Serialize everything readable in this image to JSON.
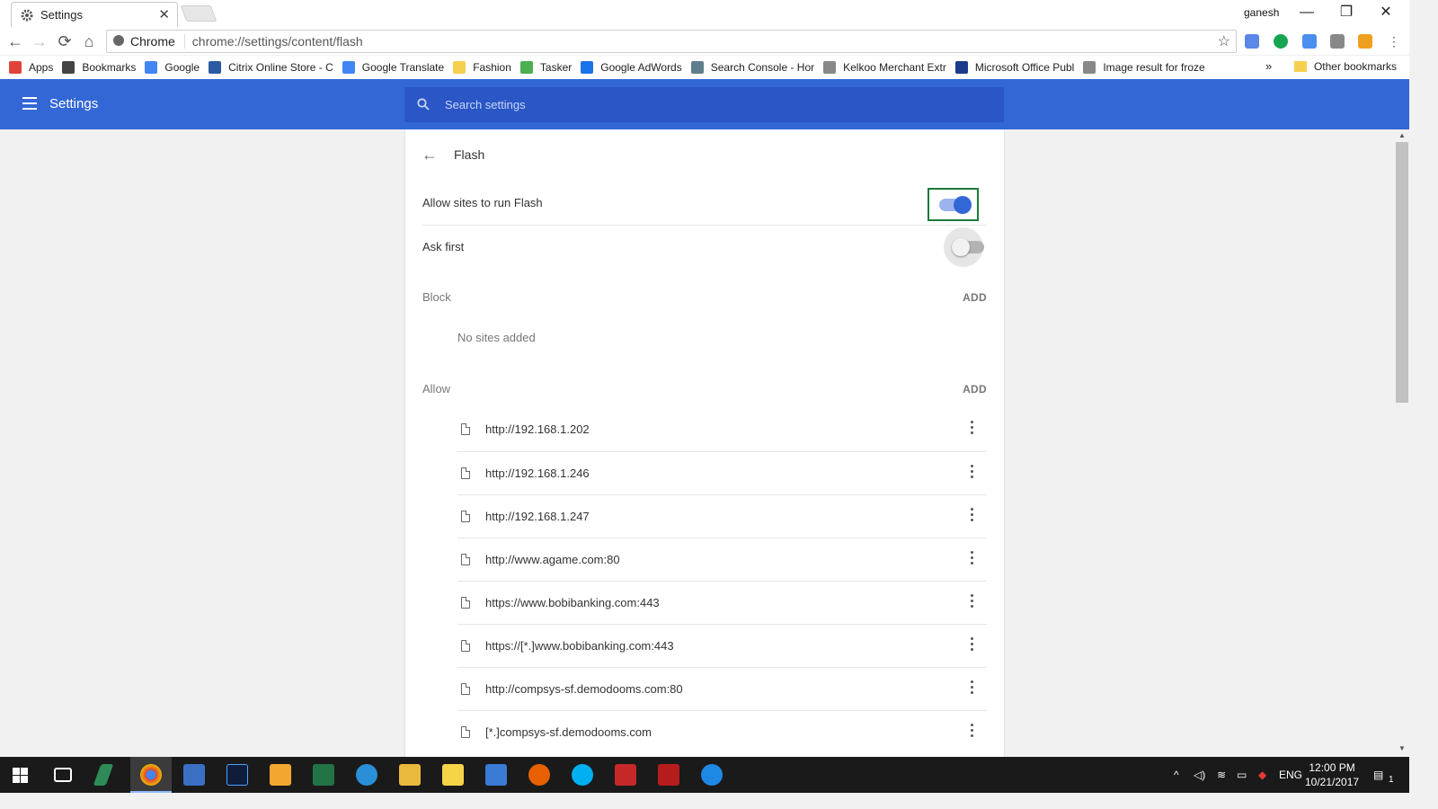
{
  "window": {
    "tab_title": "Settings",
    "tab_close": "✕",
    "user": "ganesh",
    "controls": {
      "minimize": "—",
      "restore": "❐",
      "close": "✕"
    }
  },
  "toolbar": {
    "back": "←",
    "forward": "→",
    "reload": "⟳",
    "home": "⌂",
    "site_chip": "Chrome",
    "url": "chrome://settings/content/flash",
    "star": "☆"
  },
  "bookmarks": {
    "items": [
      {
        "label": "Apps",
        "icon": "apps-grid-icon",
        "color": "#e0433a"
      },
      {
        "label": "Bookmarks",
        "icon": "star-icon",
        "color": "#444444"
      },
      {
        "label": "Google",
        "icon": "google-icon",
        "color": "#4285f4"
      },
      {
        "label": "Citrix Online Store - C",
        "icon": "citrix-icon",
        "color": "#2b5aa3"
      },
      {
        "label": "Google Translate",
        "icon": "translate-icon",
        "color": "#4285f4"
      },
      {
        "label": "Fashion",
        "icon": "folder-icon",
        "color": "#f7cf4f"
      },
      {
        "label": "Tasker",
        "icon": "tasker-icon",
        "color": "#4caf50"
      },
      {
        "label": "Google AdWords",
        "icon": "adwords-icon",
        "color": "#1a73e8"
      },
      {
        "label": "Search Console - Hor",
        "icon": "search-console-icon",
        "color": "#607d8b"
      },
      {
        "label": "Kelkoo Merchant Extr",
        "icon": "page-icon",
        "color": "#888888"
      },
      {
        "label": "Microsoft Office Publ",
        "icon": "office-icon",
        "color": "#1b3a8a"
      },
      {
        "label": "Image result for froze",
        "icon": "page-icon",
        "color": "#888888"
      }
    ],
    "overflow": "»",
    "other": "Other bookmarks"
  },
  "header": {
    "title": "Settings",
    "search_placeholder": "Search settings"
  },
  "flash": {
    "back": "←",
    "title": "Flash",
    "allow_label": "Allow sites to run Flash",
    "allow_on": true,
    "ask_label": "Ask first",
    "ask_on": false,
    "block_label": "Block",
    "block_add": "ADD",
    "block_empty": "No sites added",
    "allow_section_label": "Allow",
    "allow_add": "ADD",
    "allow_sites": [
      "http://192.168.1.202",
      "http://192.168.1.246",
      "http://192.168.1.247",
      "http://www.agame.com:80",
      "https://www.bobibanking.com:443",
      "https://[*.]www.bobibanking.com:443",
      "http://compsys-sf.demodooms.com:80",
      "[*.]compsys-sf.demodooms.com"
    ]
  },
  "taskbar": {
    "language": "ENG",
    "time": "12:00 PM",
    "date": "10/21/2017",
    "notification_count": "1"
  },
  "colors": {
    "header_blue": "#3367d6",
    "search_blue": "#2a56c6",
    "focus_green": "#1e7a3c"
  }
}
